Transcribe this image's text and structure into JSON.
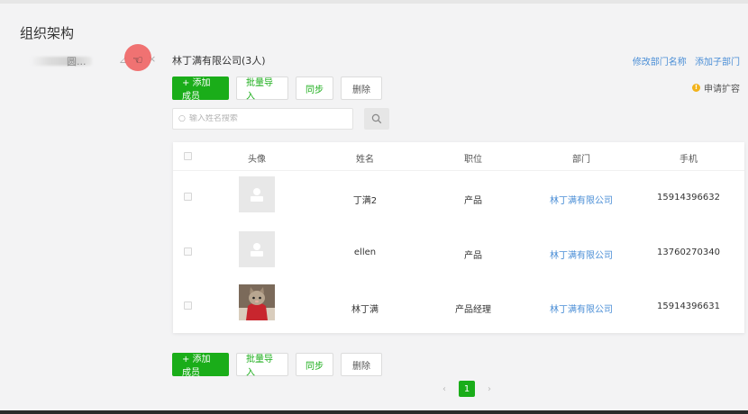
{
  "page": {
    "title": "组织架构"
  },
  "tree": {
    "node_label": "圆..."
  },
  "company": {
    "title": "林丁满有限公司(3人)",
    "rename_link": "修改部门名称",
    "add_sub_link": "添加子部门",
    "apply_expand": "申请扩容"
  },
  "toolbar": {
    "add_member": "+ 添加成员",
    "batch_import": "批量导入",
    "sync": "同步",
    "delete": "删除"
  },
  "search": {
    "placeholder": "输入姓名搜索",
    "value": ""
  },
  "table": {
    "columns": [
      "头像",
      "姓名",
      "职位",
      "部门",
      "手机"
    ],
    "rows": [
      {
        "name": "丁满2",
        "position": "产品",
        "department": "林丁满有限公司",
        "phone": "15914396632",
        "avatar": "placeholder"
      },
      {
        "name": "ellen",
        "position": "产品",
        "department": "林丁满有限公司",
        "phone": "13760270340",
        "avatar": "placeholder"
      },
      {
        "name": "林丁满",
        "position": "产品经理",
        "department": "林丁满有限公司",
        "phone": "15914396631",
        "avatar": "cat-photo"
      }
    ]
  },
  "pagination": {
    "prev": "‹",
    "current": "1",
    "next": "›"
  },
  "colors": {
    "primary": "#1aad19",
    "link": "#4a8ed6",
    "warn": "#f2b31b"
  }
}
